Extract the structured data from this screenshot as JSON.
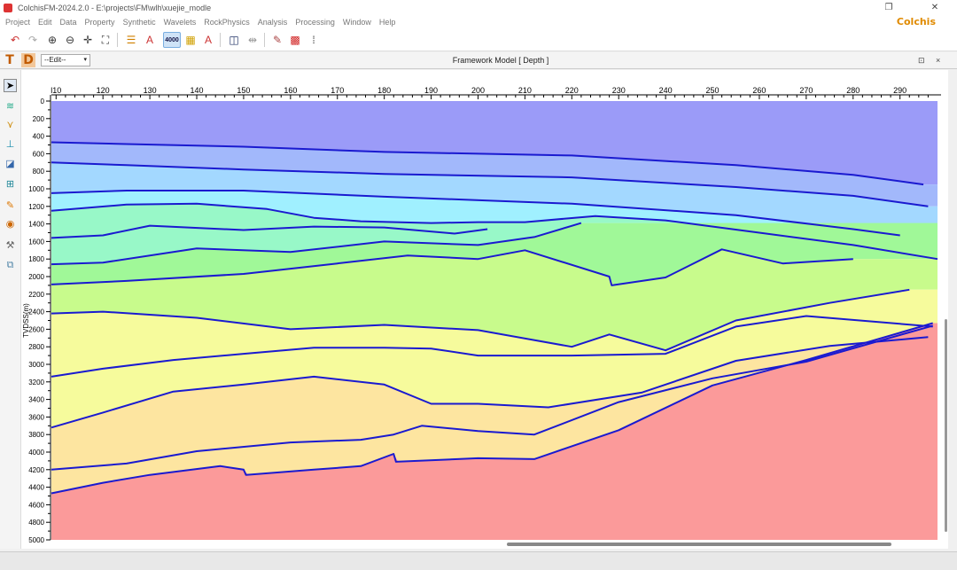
{
  "window": {
    "title": "ColchisFM-2024.2.0 - E:\\projects\\FM\\wlh\\xuejie_modle",
    "brand": "Colchis",
    "minimize_glyph": "—",
    "restore_glyph": "❐",
    "close_glyph": "✕"
  },
  "menu": [
    "Project",
    "Edit",
    "Data",
    "Property",
    "Synthetic",
    "Wavelets",
    "RockPhysics",
    "Analysis",
    "Processing",
    "Window",
    "Help"
  ],
  "toolbar": {
    "icons": [
      "undo-icon",
      "redo-icon",
      "zoom-in-icon",
      "zoom-out-icon",
      "pan-icon",
      "fit-view-icon",
      "horizon-list-icon",
      "horizon-attr-icon",
      "depth-convert-icon",
      "color-grid-icon",
      "text-attr-icon",
      "split-view-icon",
      "compare-view-icon",
      "velocity-icon",
      "heatmap-icon",
      "grid-1d-icon"
    ],
    "depth_label": "4000"
  },
  "subbar": {
    "t_label": "T",
    "d_label": "D",
    "mode_select": "--Edit--",
    "caret": "▾",
    "title": "Framework Model [ Depth ]",
    "pin_glyph": "⊡",
    "close_glyph": "×"
  },
  "left_tools": [
    "pointer-icon",
    "horizons-icon",
    "faults-icon",
    "well-icon",
    "layer-icon",
    "grid-icon",
    "pencil-icon",
    "bucket-icon",
    "tool-icon",
    "stack-icon"
  ],
  "chart_data": {
    "type": "area",
    "title": "Framework Model [ Depth ]",
    "ylabel": "TVDSS(m)",
    "xlabel": "",
    "x_ticks": [
      110,
      120,
      130,
      140,
      150,
      160,
      170,
      180,
      190,
      200,
      210,
      220,
      230,
      240,
      250,
      260,
      270,
      280,
      290
    ],
    "x_tick_labels": [
      "l10",
      "120",
      "130",
      "140",
      "150",
      "160",
      "170",
      "180",
      "190",
      "200",
      "210",
      "220",
      "230",
      "240",
      "250",
      "260",
      "270",
      "280",
      "290"
    ],
    "y_ticks": [
      0,
      200,
      400,
      600,
      800,
      1000,
      1200,
      1400,
      1600,
      1800,
      2000,
      2200,
      2400,
      2600,
      2800,
      3000,
      3200,
      3400,
      3600,
      3800,
      4000,
      4200,
      4400,
      4600,
      4800,
      5000
    ],
    "xlim": [
      109,
      298
    ],
    "ylim": [
      0,
      5000
    ],
    "y_inverted": true,
    "grid": false,
    "horizon_color": "#1a1ad0",
    "layer_colors": [
      "#9b9bf8",
      "#a2b8fb",
      "#a3d8ff",
      "#a0f0ff",
      "#98f8c8",
      "#a0f898",
      "#c8fb8c",
      "#f6fb9c",
      "#fde5a0",
      "#fb9a9a"
    ],
    "horizons": [
      {
        "x": [
          109,
          125,
          150,
          180,
          220,
          255,
          280,
          295
        ],
        "y": [
          470,
          490,
          520,
          580,
          620,
          730,
          840,
          950
        ]
      },
      {
        "x": [
          109,
          125,
          150,
          180,
          220,
          255,
          280,
          296
        ],
        "y": [
          700,
          730,
          780,
          830,
          870,
          980,
          1080,
          1200
        ]
      },
      {
        "x": [
          109,
          125,
          150,
          180,
          220,
          255,
          280,
          290
        ],
        "y": [
          1050,
          1020,
          1020,
          1090,
          1170,
          1300,
          1460,
          1530
        ]
      },
      {
        "x": [
          109,
          125,
          140,
          155,
          165,
          175,
          190,
          200,
          210,
          225,
          240,
          260,
          280,
          298
        ],
        "y": [
          1250,
          1180,
          1170,
          1230,
          1330,
          1370,
          1390,
          1380,
          1380,
          1310,
          1360,
          1500,
          1640,
          1800
        ]
      },
      {
        "x": [
          109,
          120,
          130,
          150,
          165,
          180,
          195,
          202
        ],
        "y": [
          1560,
          1530,
          1420,
          1470,
          1430,
          1440,
          1510,
          1460
        ]
      },
      {
        "x": [
          109,
          120,
          140,
          160,
          180,
          200,
          212,
          222
        ],
        "y": [
          1860,
          1840,
          1680,
          1720,
          1600,
          1640,
          1550,
          1390
        ]
      },
      {
        "x": [
          109,
          125,
          150,
          170,
          185,
          200,
          210,
          228,
          228.5,
          240,
          252,
          265,
          280
        ],
        "y": [
          2090,
          2050,
          1970,
          1850,
          1760,
          1800,
          1700,
          2000,
          2100,
          2010,
          1690,
          1850,
          1800
        ]
      },
      {
        "x": [
          109,
          120,
          140,
          160,
          180,
          200,
          220,
          228,
          240,
          255,
          275,
          292
        ],
        "y": [
          2420,
          2400,
          2470,
          2600,
          2550,
          2610,
          2800,
          2660,
          2840,
          2500,
          2300,
          2150
        ]
      },
      {
        "x": [
          109,
          120,
          135,
          150,
          165,
          180,
          190,
          200,
          220,
          240,
          255,
          270,
          297
        ],
        "y": [
          3140,
          3050,
          2950,
          2880,
          2810,
          2810,
          2820,
          2900,
          2900,
          2880,
          2570,
          2450,
          2570
        ]
      },
      {
        "x": [
          109,
          120,
          135,
          150,
          165,
          180,
          190,
          200,
          215,
          235,
          255,
          275,
          296
        ],
        "y": [
          3720,
          3550,
          3310,
          3230,
          3140,
          3230,
          3450,
          3450,
          3490,
          3320,
          2960,
          2790,
          2690
        ]
      },
      {
        "x": [
          109,
          125,
          140,
          160,
          175,
          182,
          188,
          200,
          212,
          230,
          250,
          270,
          297
        ],
        "y": [
          4200,
          4130,
          3990,
          3890,
          3860,
          3800,
          3700,
          3760,
          3800,
          3430,
          3160,
          2970,
          2560
        ]
      },
      {
        "x": [
          109,
          120,
          130,
          145,
          150,
          150.5,
          165,
          175,
          182,
          182.5,
          200,
          212,
          230,
          250,
          270,
          297
        ],
        "y": [
          4470,
          4350,
          4260,
          4160,
          4200,
          4260,
          4200,
          4160,
          4020,
          4110,
          4070,
          4080,
          3750,
          3240,
          2950,
          2530
        ]
      }
    ]
  }
}
